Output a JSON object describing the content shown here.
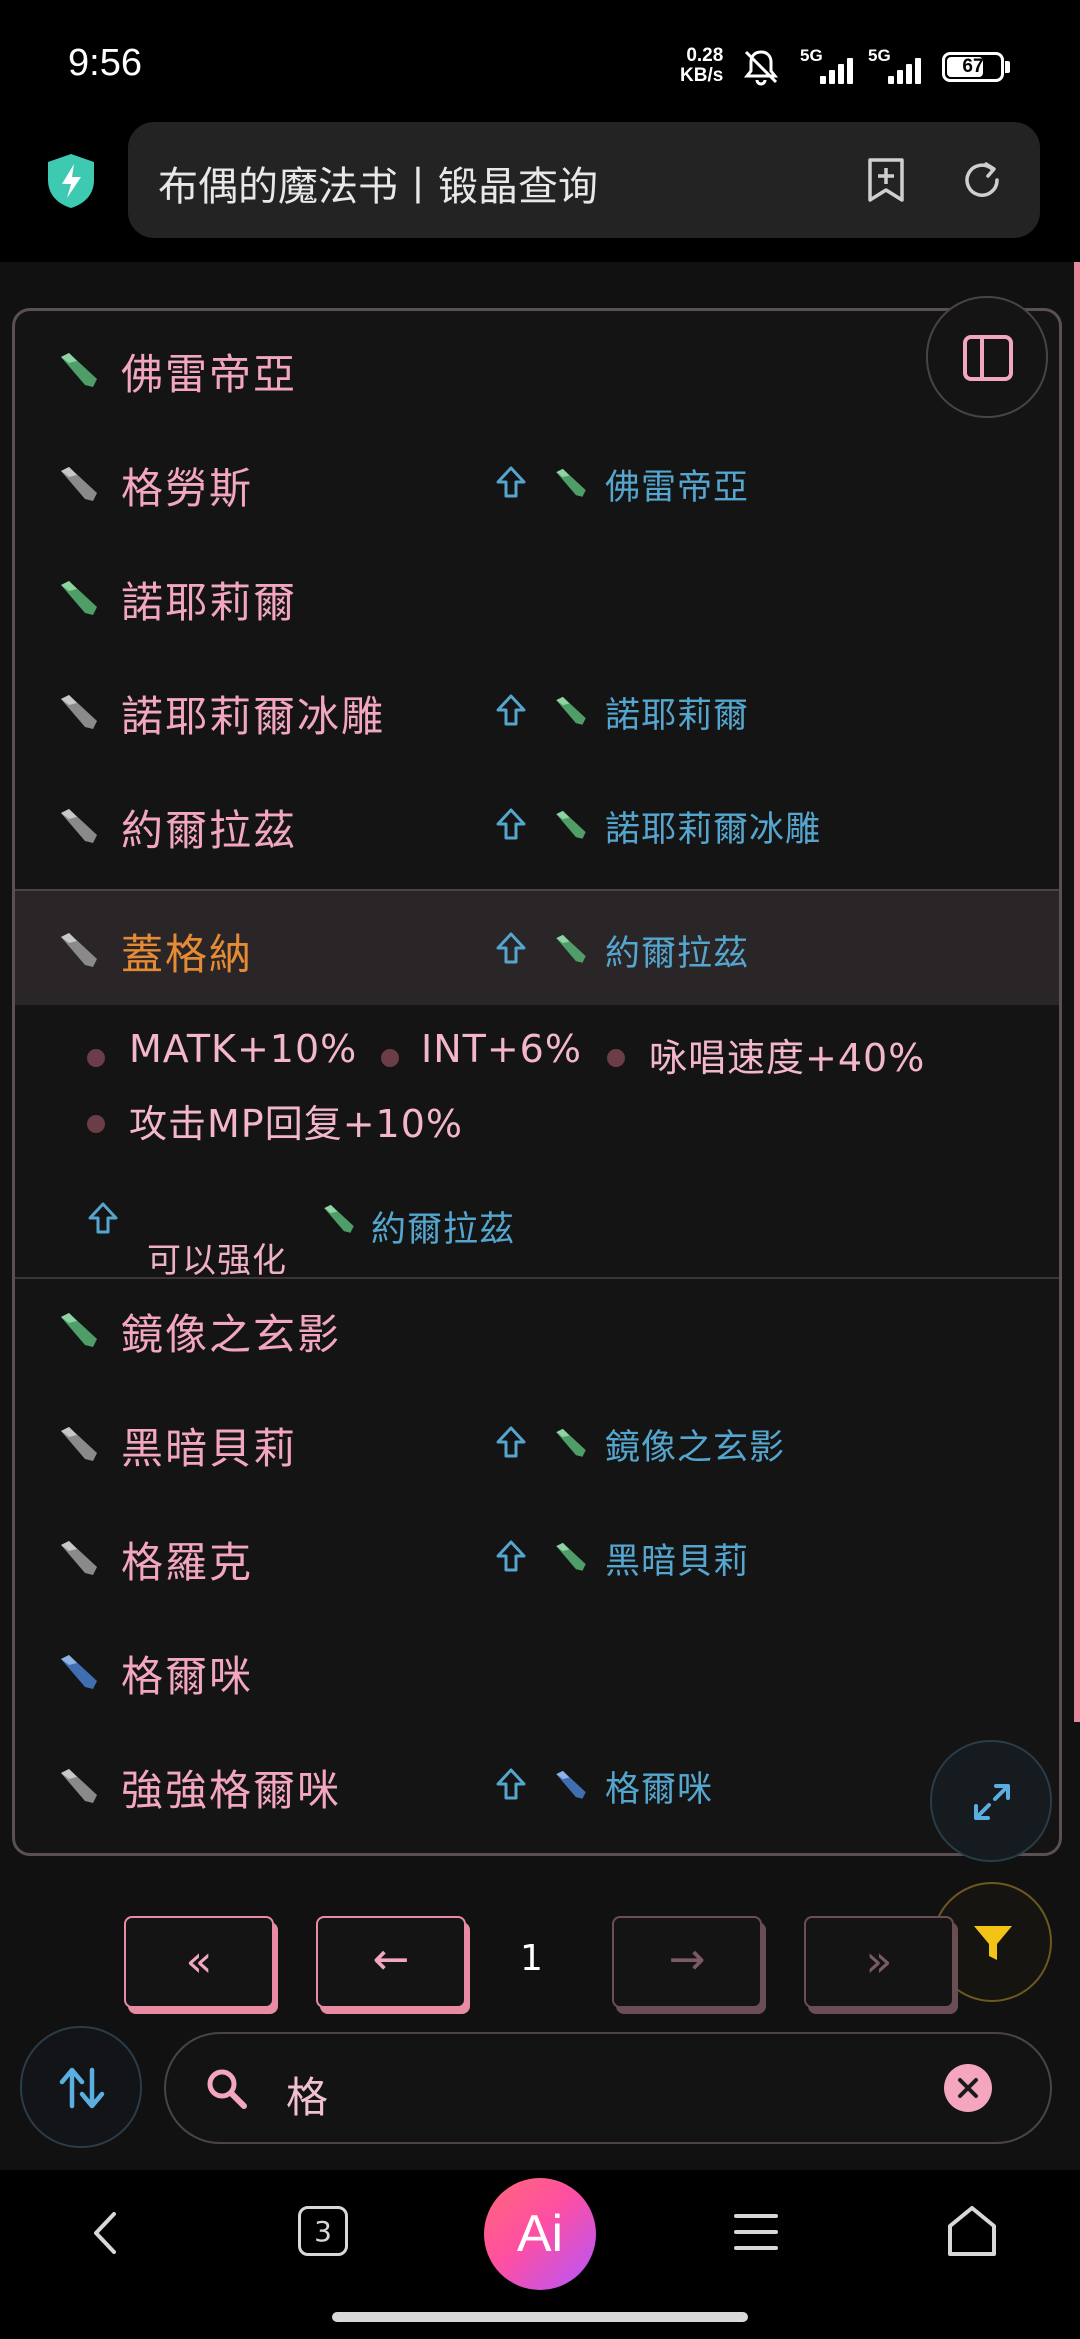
{
  "status_bar": {
    "time": "9:56",
    "net_speed_value": "0.28",
    "net_speed_unit": "KB/s",
    "signal1_label": "5G",
    "signal2_label": "5G",
    "battery": "67"
  },
  "browser": {
    "page_title": "布偶的魔法书丨锻晶查询"
  },
  "list": {
    "rows": [
      {
        "name": "佛雷帝亞",
        "crystal": "green"
      },
      {
        "name": "格勞斯",
        "crystal": "gray",
        "upgrade": "佛雷帝亞",
        "upgrade_crystal": "green"
      },
      {
        "name": "諾耶莉爾",
        "crystal": "green"
      },
      {
        "name": "諾耶莉爾冰雕",
        "crystal": "gray",
        "upgrade": "諾耶莉爾",
        "upgrade_crystal": "green"
      },
      {
        "name": "約爾拉茲",
        "crystal": "gray",
        "upgrade": "諾耶莉爾冰雕",
        "upgrade_crystal": "green"
      },
      {
        "name": "蓋格納",
        "crystal": "gray",
        "upgrade": "約爾拉茲",
        "upgrade_crystal": "green",
        "selected": true
      },
      {
        "name": "鏡像之玄影",
        "crystal": "green"
      },
      {
        "name": "黑暗貝莉",
        "crystal": "gray",
        "upgrade": "鏡像之玄影",
        "upgrade_crystal": "green"
      },
      {
        "name": "格羅克",
        "crystal": "gray",
        "upgrade": "黑暗貝莉",
        "upgrade_crystal": "green"
      },
      {
        "name": "格爾咪",
        "crystal": "blue"
      },
      {
        "name": "強強格爾咪",
        "crystal": "gray",
        "upgrade": "格爾咪",
        "upgrade_crystal": "blue"
      }
    ]
  },
  "detail": {
    "stats": [
      "MATK+10%",
      "INT+6%",
      "咏唱速度+40%",
      "攻击MP回复+10%"
    ],
    "refine_label": "可以强化",
    "refine_target": "約爾拉茲"
  },
  "pagination": {
    "first_label": "«",
    "prev_label": "←",
    "page": "1",
    "next_label": "→",
    "last_label": "»"
  },
  "search": {
    "value": "格"
  },
  "bottom_nav": {
    "tabs_count": "3",
    "ai_label": "Ai"
  },
  "colors": {
    "accent_pink": "#f2a6bf",
    "selected_orange": "#e58a35",
    "link_blue": "#55a6cf",
    "crystal_green": "#4f9e68",
    "crystal_gray": "#8a8a8a",
    "crystal_blue": "#3f6fb0",
    "filter_yellow": "#f3c416"
  }
}
